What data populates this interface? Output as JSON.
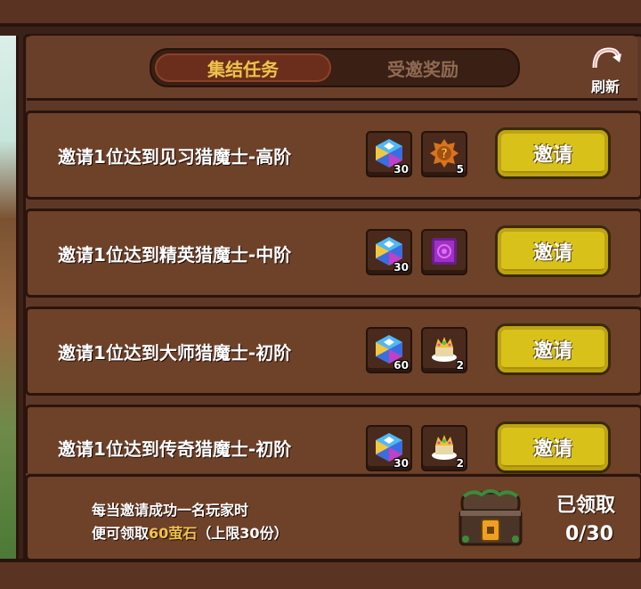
{
  "tabs": [
    {
      "label": "集结任务",
      "active": true
    },
    {
      "label": "受邀奖励",
      "active": false
    }
  ],
  "refresh": {
    "label": "刷新",
    "icon": "refresh-icon"
  },
  "tasks": [
    {
      "text": "邀请1位达到见习猎魔士-高阶",
      "rewards": [
        {
          "icon": "gem-icon",
          "count": "30"
        },
        {
          "icon": "mystery-gear-icon",
          "count": "5"
        }
      ],
      "button": "邀请"
    },
    {
      "text": "邀请1位达到精英猎魔士-中阶",
      "rewards": [
        {
          "icon": "gem-icon",
          "count": "30"
        },
        {
          "icon": "purple-portal-icon",
          "count": ""
        }
      ],
      "button": "邀请"
    },
    {
      "text": "邀请1位达到大师猎魔士-初阶",
      "rewards": [
        {
          "icon": "gem-icon",
          "count": "60"
        },
        {
          "icon": "crown-cake-icon",
          "count": "2"
        }
      ],
      "button": "邀请"
    },
    {
      "text": "邀请1位达到传奇猎魔士-初阶",
      "rewards": [
        {
          "icon": "gem-icon",
          "count": "30"
        },
        {
          "icon": "crown-cake-icon",
          "count": "2"
        }
      ],
      "button": "邀请"
    }
  ],
  "footer": {
    "line1": "每当邀请成功一名玩家时",
    "line2_prefix": "便可领取",
    "line2_highlight": "60萤石",
    "line2_suffix": "（上限30份）",
    "claimed_label": "已领取",
    "claimed_count": "0/30",
    "chest_icon": "treasure-chest-icon"
  },
  "colors": {
    "accent_gold": "#f0c24a",
    "button_yellow": "#d8c21a",
    "panel_brown": "#6e4129"
  }
}
